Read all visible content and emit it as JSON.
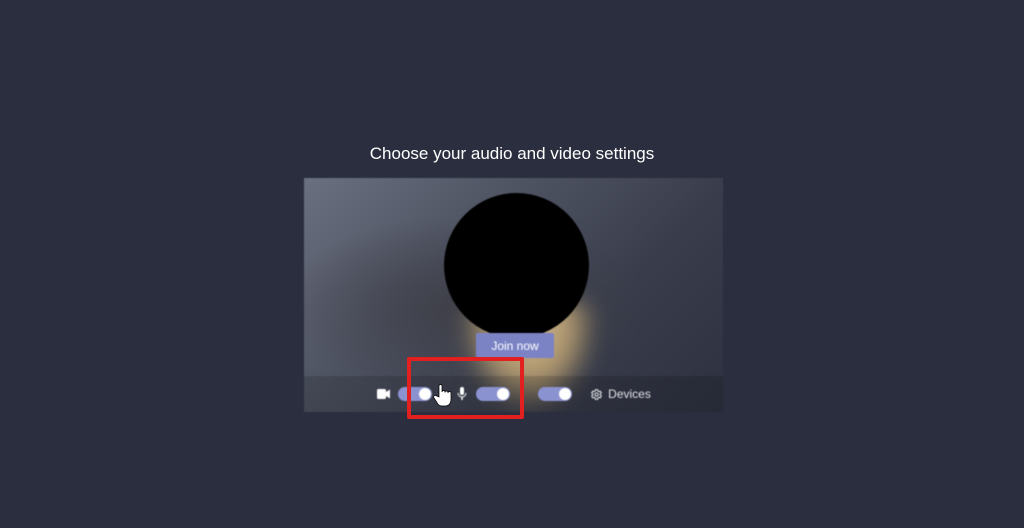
{
  "heading": "Choose your audio and video settings",
  "join_label": "Join now",
  "devices_label": "Devices",
  "toggles": {
    "video": {
      "on": true
    },
    "blur": {
      "on": true
    },
    "mic": {
      "on": true
    }
  },
  "icons": {
    "video": "video-camera-icon",
    "mic": "microphone-icon",
    "gear": "gear-icon"
  },
  "colors": {
    "accent": "#7b83c5",
    "annotation": "#e22020"
  }
}
